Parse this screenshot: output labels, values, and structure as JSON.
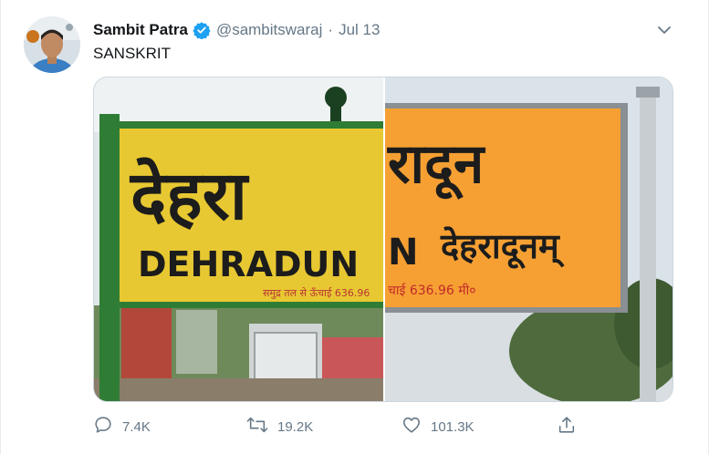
{
  "tweet": {
    "author_name": "Sambit Patra",
    "handle": "@sambitswaraj",
    "separator": "·",
    "date": "Jul 13",
    "text": "SANSKRIT"
  },
  "media": {
    "left_sign": {
      "hindi": "देहरा",
      "english": "DEHRADUN",
      "small": "समुद्र तल से ऊँचाई 636.96"
    },
    "right_sign": {
      "hindi_top": "रादून",
      "english_fragment": "N",
      "sanskrit": "देहरादूनम्",
      "small": "चाई 636.96 मी०"
    }
  },
  "actions": {
    "replies": "7.4K",
    "retweets": "19.2K",
    "likes": "101.3K"
  },
  "icons": [
    "verified-badge-icon",
    "chevron-down-icon",
    "reply-icon",
    "retweet-icon",
    "like-icon",
    "share-icon"
  ],
  "colors": {
    "accent": "#1da1f2",
    "muted": "#657786",
    "left_sign_yellow": "#e8c832",
    "right_sign_orange": "#f6a033"
  }
}
